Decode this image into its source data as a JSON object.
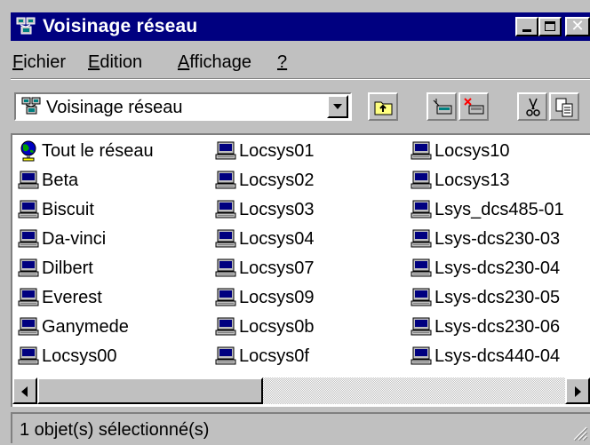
{
  "window": {
    "title": "Voisinage réseau",
    "title_icon": "network-neighborhood-icon",
    "buttons": {
      "minimize": "_",
      "maximize": "□",
      "close": "×"
    }
  },
  "menu": [
    {
      "accel": "F",
      "rest": "ichier"
    },
    {
      "accel": "E",
      "rest": "dition"
    },
    {
      "accel": "A",
      "rest": "ffichage"
    },
    {
      "accel": "?",
      "rest": ""
    }
  ],
  "toolbar": {
    "address_value": "Voisinage réseau",
    "icons": [
      "up-one-level-icon",
      "map-network-drive-icon",
      "disconnect-network-drive-icon",
      "cut-icon",
      "copy-icon"
    ]
  },
  "items": [
    {
      "label": "Tout le réseau",
      "icon": "entire-network-icon"
    },
    {
      "label": "Beta",
      "icon": "computer-icon"
    },
    {
      "label": "Biscuit",
      "icon": "computer-icon"
    },
    {
      "label": "Da-vinci",
      "icon": "computer-icon"
    },
    {
      "label": "Dilbert",
      "icon": "computer-icon"
    },
    {
      "label": "Everest",
      "icon": "computer-icon"
    },
    {
      "label": "Ganymede",
      "icon": "computer-icon"
    },
    {
      "label": "Locsys00",
      "icon": "computer-icon"
    },
    {
      "label": "Locsys01",
      "icon": "computer-icon"
    },
    {
      "label": "Locsys02",
      "icon": "computer-icon"
    },
    {
      "label": "Locsys03",
      "icon": "computer-icon"
    },
    {
      "label": "Locsys04",
      "icon": "computer-icon"
    },
    {
      "label": "Locsys07",
      "icon": "computer-icon"
    },
    {
      "label": "Locsys09",
      "icon": "computer-icon"
    },
    {
      "label": "Locsys0b",
      "icon": "computer-icon"
    },
    {
      "label": "Locsys0f",
      "icon": "computer-icon"
    },
    {
      "label": "Locsys10",
      "icon": "computer-icon"
    },
    {
      "label": "Locsys13",
      "icon": "computer-icon"
    },
    {
      "label": "Lsys_dcs485-01",
      "icon": "computer-icon"
    },
    {
      "label": "Lsys-dcs230-03",
      "icon": "computer-icon"
    },
    {
      "label": "Lsys-dcs230-04",
      "icon": "computer-icon"
    },
    {
      "label": "Lsys-dcs230-05",
      "icon": "computer-icon"
    },
    {
      "label": "Lsys-dcs230-06",
      "icon": "computer-icon"
    },
    {
      "label": "Lsys-dcs440-04",
      "icon": "computer-icon"
    }
  ],
  "status": {
    "text": "1 objet(s) sélectionné(s)"
  },
  "colors": {
    "title_bar": "#000080",
    "face": "#c0c0c0",
    "list_bg": "#ffffff"
  }
}
